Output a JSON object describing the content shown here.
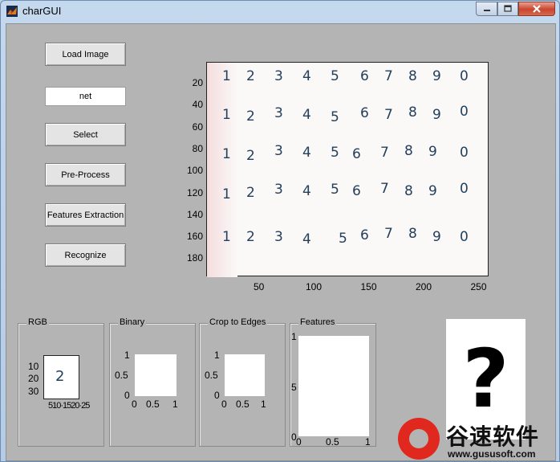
{
  "window": {
    "title": "charGUI"
  },
  "buttons": {
    "load": "Load Image",
    "select": "Select",
    "preprocess": "Pre-Process",
    "features": "Features Extraction",
    "recognize": "Recognize"
  },
  "net_input": {
    "value": "net"
  },
  "main_axes": {
    "xticks": [
      "50",
      "100",
      "150",
      "200",
      "250"
    ],
    "yticks": [
      "20",
      "40",
      "60",
      "80",
      "100",
      "120",
      "140",
      "160",
      "180"
    ],
    "digit_rows": [
      [
        "1",
        "2",
        "3",
        "4",
        "5",
        "6",
        "7",
        "8",
        "9",
        "0"
      ],
      [
        "1",
        "2",
        "3",
        "4",
        "5",
        "6",
        "7",
        "8",
        "9",
        "0"
      ],
      [
        "1",
        "2",
        "3",
        "4",
        "5",
        "6",
        "7",
        "8",
        "9",
        "0"
      ],
      [
        "1",
        "2",
        "3",
        "4",
        "5",
        "6",
        "7",
        "8",
        "9",
        "0"
      ],
      [
        "1",
        "2",
        "3",
        "4",
        "5",
        "6",
        "7",
        "8",
        "9",
        "0"
      ]
    ]
  },
  "panels": {
    "rgb": {
      "title": "RGB",
      "yticks": [
        "10",
        "20",
        "30"
      ],
      "xtick_label": "510·1520·25",
      "digit": "2"
    },
    "binary": {
      "title": "Binary",
      "yticks": [
        "1",
        "0.5",
        "0"
      ],
      "xticks": [
        "0",
        "0.5",
        "1"
      ]
    },
    "crop": {
      "title": "Crop to Edges",
      "yticks": [
        "1",
        "0.5",
        "0"
      ],
      "xticks": [
        "0",
        "0.5",
        "1"
      ]
    },
    "features": {
      "title": "Features",
      "yticks": [
        "1",
        "5",
        "0"
      ],
      "xticks": [
        "0",
        "0.5",
        "1"
      ]
    }
  },
  "result": {
    "symbol": "?"
  },
  "watermark": {
    "text": "谷速软件",
    "url": "www.gususoft.com"
  },
  "colors": {
    "figure_bg": "#b4b4b4",
    "digit_ink": "#23405c",
    "close_red": "#c8452d",
    "watermark_red": "#e0281f"
  }
}
